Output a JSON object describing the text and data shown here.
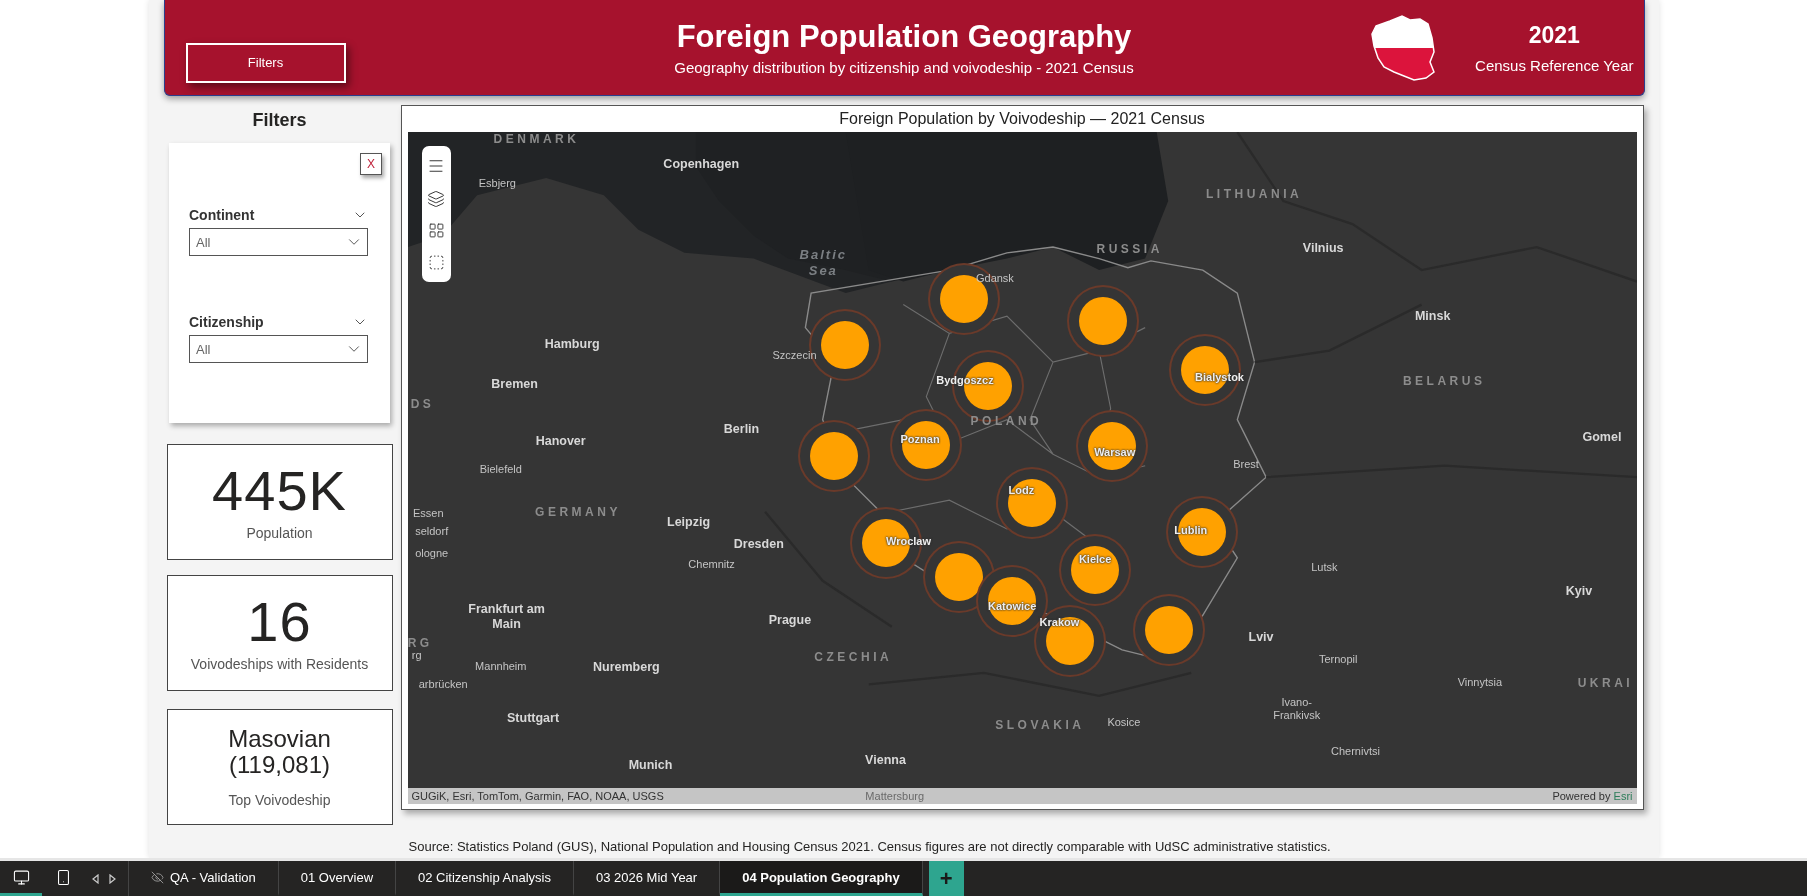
{
  "header": {
    "filters_button": "Filters",
    "title": "Foreign Population Geography",
    "subtitle": "Geography distribution by citizenship and voivodeship - 2021 Census",
    "year": "2021",
    "year_caption": "Census Reference Year"
  },
  "filters_panel": {
    "title": "Filters",
    "close": "X",
    "slicers": [
      {
        "label": "Continent",
        "value": "All"
      },
      {
        "label": "Citizenship",
        "value": "All"
      }
    ]
  },
  "kpis": [
    {
      "kind": "big",
      "value": "445K",
      "caption": "Population"
    },
    {
      "kind": "big",
      "value": "16",
      "caption": "Voivodeships with Residents"
    },
    {
      "kind": "text",
      "value": "Masovian",
      "detail": "(119,081)",
      "caption": "Top Voivodeship"
    }
  ],
  "map": {
    "title": "Foreign Population by Voivodeship — 2021 Census",
    "labels": [
      {
        "text": "DENMARK",
        "kind": "country"
      },
      {
        "text": "Copenhagen",
        "kind": "city"
      },
      {
        "text": "Esbjerg",
        "kind": "town"
      },
      {
        "text": "LITHUANIA",
        "kind": "country"
      },
      {
        "text": "Baltic Sea",
        "kind": "sea"
      },
      {
        "text": "RUSSIA",
        "kind": "country"
      },
      {
        "text": "Vilnius",
        "kind": "city"
      },
      {
        "text": "Gdansk",
        "kind": "town"
      },
      {
        "text": "Minsk",
        "kind": "city"
      },
      {
        "text": "Hamburg",
        "kind": "city"
      },
      {
        "text": "Szczecin",
        "kind": "town"
      },
      {
        "text": "Bremen",
        "kind": "city"
      },
      {
        "text": "Bydgoszcz",
        "kind": "marker"
      },
      {
        "text": "Bialystok",
        "kind": "marker"
      },
      {
        "text": "BELARUS",
        "kind": "country"
      },
      {
        "text": "DS",
        "kind": "country"
      },
      {
        "text": "POLAND",
        "kind": "country"
      },
      {
        "text": "Hanover",
        "kind": "city"
      },
      {
        "text": "Berlin",
        "kind": "city"
      },
      {
        "text": "Poznan",
        "kind": "marker"
      },
      {
        "text": "Gomel",
        "kind": "city"
      },
      {
        "text": "Bielefeld",
        "kind": "town"
      },
      {
        "text": "Warsaw",
        "kind": "marker"
      },
      {
        "text": "Brest",
        "kind": "town"
      },
      {
        "text": "Lodz",
        "kind": "marker"
      },
      {
        "text": "Essen",
        "kind": "town"
      },
      {
        "text": "GERMANY",
        "kind": "country"
      },
      {
        "text": "Leipzig",
        "kind": "city"
      },
      {
        "text": "seldorf",
        "kind": "town"
      },
      {
        "text": "Lublin",
        "kind": "marker"
      },
      {
        "text": "Wroclaw",
        "kind": "marker"
      },
      {
        "text": "Dresden",
        "kind": "city"
      },
      {
        "text": "ologne",
        "kind": "town"
      },
      {
        "text": "Chemnitz",
        "kind": "town"
      },
      {
        "text": "Kielce",
        "kind": "marker"
      },
      {
        "text": "Lutsk",
        "kind": "town"
      },
      {
        "text": "Kyiv",
        "kind": "city"
      },
      {
        "text": "Frankfurt am Main",
        "kind": "city"
      },
      {
        "text": "Prague",
        "kind": "city"
      },
      {
        "text": "Katowice",
        "kind": "marker"
      },
      {
        "text": "Krakow",
        "kind": "marker"
      },
      {
        "text": "RG",
        "kind": "country"
      },
      {
        "text": "Lviv",
        "kind": "city"
      },
      {
        "text": "rg",
        "kind": "town"
      },
      {
        "text": "Mannheim",
        "kind": "town"
      },
      {
        "text": "Nuremberg",
        "kind": "city"
      },
      {
        "text": "CZECHIA",
        "kind": "country"
      },
      {
        "text": "Ternopil",
        "kind": "town"
      },
      {
        "text": "arbrücken",
        "kind": "town"
      },
      {
        "text": "Vinnytsia",
        "kind": "town"
      },
      {
        "text": "UKRAI",
        "kind": "country"
      },
      {
        "text": "Stuttgart",
        "kind": "city"
      },
      {
        "text": "SLOVAKIA",
        "kind": "country"
      },
      {
        "text": "Kosice",
        "kind": "town"
      },
      {
        "text": "Ivano-Frankivsk",
        "kind": "town"
      },
      {
        "text": "Munich",
        "kind": "city"
      },
      {
        "text": "Vienna",
        "kind": "city"
      },
      {
        "text": "Chernivtsi",
        "kind": "town"
      },
      {
        "text": "Mattersburg",
        "kind": "faded"
      }
    ],
    "attribution": "GUGiK, Esri, TomTom, Garmin, FAO, NOAA, USGS",
    "powered_by": "Powered by",
    "powered_link": "Esri"
  },
  "source_note": "Source: Statistics Poland (GUS), National Population and Housing Census 2021. Census figures are not directly comparable with UdSC administrative statistics.",
  "bottom_bar": {
    "view_modes": [
      {
        "kind": "desktop",
        "selected": true
      },
      {
        "kind": "mobile",
        "selected": false
      }
    ],
    "pages": [
      {
        "label": "QA - Validation",
        "hidden": true,
        "selected": false
      },
      {
        "label": "01 Overview",
        "hidden": false,
        "selected": false
      },
      {
        "label": "02 Citizenship Analysis",
        "hidden": false,
        "selected": false
      },
      {
        "label": "03 2026 Mid Year",
        "hidden": false,
        "selected": false
      },
      {
        "label": "04 Population Geography",
        "hidden": false,
        "selected": true
      }
    ],
    "add_button": "+"
  }
}
